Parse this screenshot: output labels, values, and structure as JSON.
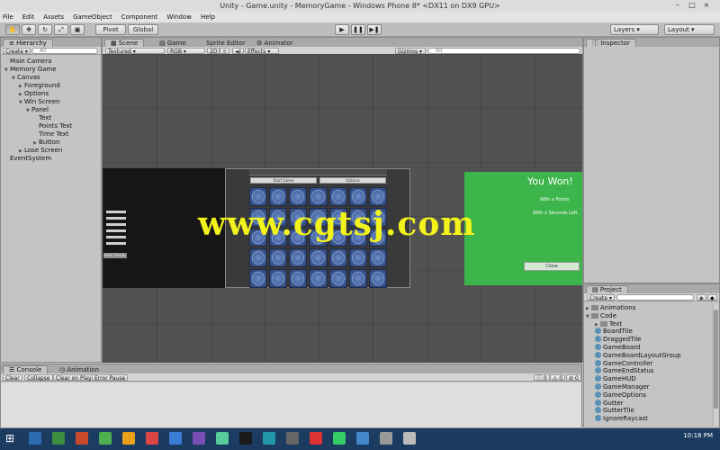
{
  "window": {
    "title": "Unity - Game.unity - MemoryGame - Windows Phone 8* <DX11 on DX9 GPU>",
    "controls": [
      "–",
      "□",
      "×"
    ]
  },
  "menu": [
    "File",
    "Edit",
    "Assets",
    "GameObject",
    "Component",
    "Window",
    "Help"
  ],
  "toolbar": {
    "pivot": "Pivot",
    "global": "Global",
    "layers": "Layers",
    "layout": "Layout"
  },
  "hierarchy": {
    "tab": "Hierarchy",
    "create": "Create",
    "search_placeholder": "All",
    "items": [
      {
        "label": "Main Camera",
        "depth": 0,
        "expand": ""
      },
      {
        "label": "Memory Game",
        "depth": 0,
        "expand": "▼"
      },
      {
        "label": "Canvas",
        "depth": 1,
        "expand": "▼"
      },
      {
        "label": "Foreground",
        "depth": 2,
        "expand": "▶"
      },
      {
        "label": "Options",
        "depth": 2,
        "expand": "▶"
      },
      {
        "label": "Win Screen",
        "depth": 2,
        "expand": "▼"
      },
      {
        "label": "Panel",
        "depth": 3,
        "expand": "▼"
      },
      {
        "label": "Text",
        "depth": 4,
        "expand": ""
      },
      {
        "label": "Points Text",
        "depth": 4,
        "expand": ""
      },
      {
        "label": "Time Text",
        "depth": 4,
        "expand": ""
      },
      {
        "label": "Button",
        "depth": 4,
        "expand": "▶"
      },
      {
        "label": "Lose Screen",
        "depth": 2,
        "expand": "▶"
      },
      {
        "label": "EventSystem",
        "depth": 0,
        "expand": ""
      }
    ]
  },
  "scene": {
    "tabs": [
      "Scene",
      "Game",
      "Sprite Editor",
      "Animator"
    ],
    "shading": "Textured",
    "rgb": "RGB",
    "mode2d": "2D",
    "effects": "Effects",
    "gizmos": "Gizmos",
    "search_placeholder": "All",
    "hud_buttons": [
      "Start Game",
      "Options"
    ],
    "win_panel": {
      "title": "You Won!",
      "points": "With x Points",
      "seconds": "With x Seconds Left",
      "close": "Close"
    },
    "left_label": "Best Streak"
  },
  "watermark": "www.cgtsj.com",
  "inspector": {
    "tab": "Inspector"
  },
  "console": {
    "tabs": [
      "Console",
      "Animation"
    ],
    "buttons": [
      "Clear",
      "Collapse",
      "Clear on Play",
      "Error Pause"
    ],
    "counts": [
      "0",
      "0",
      "0"
    ]
  },
  "project": {
    "tab": "Project",
    "create": "Create",
    "items": [
      {
        "label": "Animations",
        "kind": "folder",
        "depth": 0
      },
      {
        "label": "Code",
        "kind": "folder",
        "depth": 0
      },
      {
        "label": "Text",
        "kind": "folder",
        "depth": 1
      },
      {
        "label": "BoardTile",
        "kind": "script",
        "depth": 1
      },
      {
        "label": "DraggedTile",
        "kind": "script",
        "depth": 1
      },
      {
        "label": "GameBoard",
        "kind": "script",
        "depth": 1
      },
      {
        "label": "GameBoardLayoutGroup",
        "kind": "script",
        "depth": 1
      },
      {
        "label": "GameController",
        "kind": "script",
        "depth": 1
      },
      {
        "label": "GameEndStatus",
        "kind": "script",
        "depth": 1
      },
      {
        "label": "GameHUD",
        "kind": "script",
        "depth": 1
      },
      {
        "label": "GameManager",
        "kind": "script",
        "depth": 1
      },
      {
        "label": "GameOptions",
        "kind": "script",
        "depth": 1
      },
      {
        "label": "Gutter",
        "kind": "script",
        "depth": 1
      },
      {
        "label": "GutterTile",
        "kind": "script",
        "depth": 1
      },
      {
        "label": "IgnoreRaycast",
        "kind": "script",
        "depth": 1
      }
    ]
  },
  "taskbar": {
    "time": "10:18 PM",
    "colors": [
      "#2b6cb0",
      "#3e8e41",
      "#c94a2a",
      "#4caf50",
      "#e9a11b",
      "#d44",
      "#3a7bd5",
      "#7a4fb5",
      "#5c9",
      "#1a1a1a",
      "#29a",
      "#666",
      "#d33",
      "#3c6",
      "#48c",
      "#999",
      "#bbb"
    ]
  }
}
